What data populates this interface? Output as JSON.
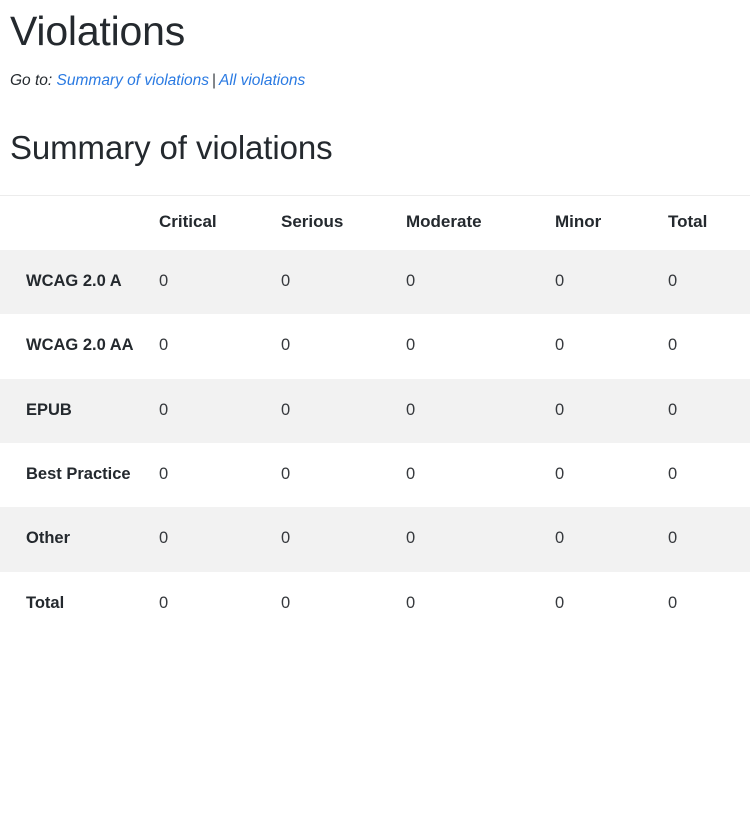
{
  "page": {
    "title": "Violations"
  },
  "goto": {
    "label": "Go to:",
    "separator": "|",
    "links": [
      {
        "text": "Summary of violations"
      },
      {
        "text": "All violations"
      }
    ]
  },
  "summary": {
    "heading": "Summary of violations",
    "table": {
      "columns": [
        "",
        "Critical",
        "Serious",
        "Moderate",
        "Minor",
        "Total"
      ],
      "rows": [
        {
          "label": "WCAG 2.0 A",
          "values": [
            "0",
            "0",
            "0",
            "0",
            "0"
          ]
        },
        {
          "label": "WCAG 2.0 AA",
          "values": [
            "0",
            "0",
            "0",
            "0",
            "0"
          ]
        },
        {
          "label": "EPUB",
          "values": [
            "0",
            "0",
            "0",
            "0",
            "0"
          ]
        },
        {
          "label": "Best Practice",
          "values": [
            "0",
            "0",
            "0",
            "0",
            "0"
          ]
        },
        {
          "label": "Other",
          "values": [
            "0",
            "0",
            "0",
            "0",
            "0"
          ]
        },
        {
          "label": "Total",
          "values": [
            "0",
            "0",
            "0",
            "0",
            "0"
          ]
        }
      ]
    }
  },
  "colors": {
    "text": "#24292e",
    "link": "#2a7ae2",
    "stripe": "#f2f2f2",
    "rule": "#ececec",
    "background": "#ffffff"
  }
}
